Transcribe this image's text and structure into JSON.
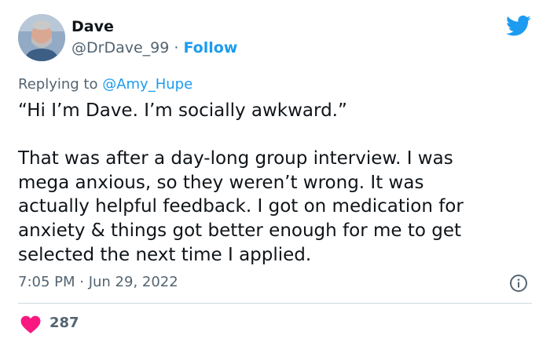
{
  "author": {
    "display_name": "Dave",
    "handle": "@DrDave_99",
    "separator": " · ",
    "follow_label": "Follow"
  },
  "reply": {
    "prefix": "Replying to ",
    "mention": "@Amy_Hupe"
  },
  "tweet": {
    "text": "“Hi I’m Dave. I’m socially awkward.”\n\nThat was after a day-long group interview. I was\nmega anxious, so they weren’t wrong. It was\nactually helpful feedback. I got on medication for\nanxiety & things got better enough for me to get\nselected the next time I applied.",
    "timestamp": "7:05 PM · Jun 29, 2022"
  },
  "engagement": {
    "likes": "287"
  },
  "colors": {
    "accent": "#1d9bf0",
    "heart": "#f91880",
    "secondary_text": "#536471",
    "divider": "#cfd9de"
  },
  "icons": {
    "brand": "twitter-bird-icon",
    "info": "info-icon",
    "like": "heart-icon"
  }
}
